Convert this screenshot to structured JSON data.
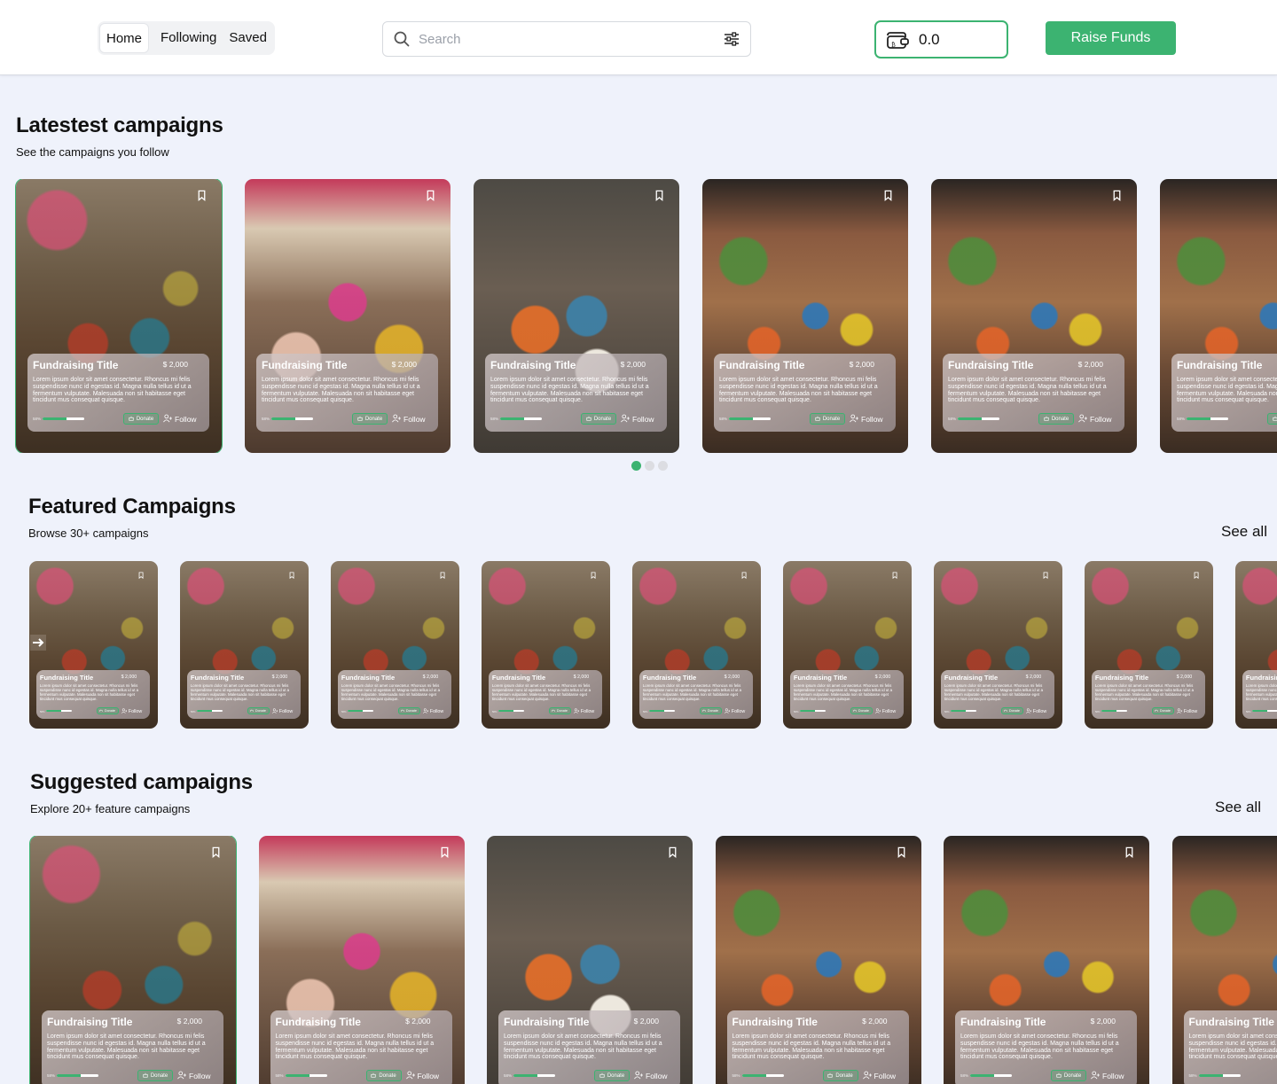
{
  "nav": {
    "tabs": [
      "Home",
      "Following",
      "Saved"
    ],
    "active": 0
  },
  "search": {
    "placeholder": "Search"
  },
  "wallet": {
    "balance": "0.0"
  },
  "raise_funds_label": "Raise Funds",
  "sections": [
    {
      "title": "Latestest campaigns",
      "subtitle": "See the campaigns you follow",
      "see_all": ""
    },
    {
      "title": "Featured Campaigns",
      "subtitle": "Browse 30+ campaigns",
      "see_all": "See all"
    },
    {
      "title": "Suggested campaigns",
      "subtitle": "Explore 20+ feature campaigns",
      "see_all": "See all"
    }
  ],
  "card": {
    "title": "Fundraising Title",
    "amount": "$ 2,000",
    "description": "Lorem ipsum dolor sit amet consectetur. Rhoncus mi felis suspendisse nunc id egestas id. Magna nulla tellus id ut a fermentum vulputate. Malesuada non sit habitasse eget tincidunt mus consequat quisque.",
    "progress_label": "58%",
    "progress": 0.58,
    "donate_label": "Donate",
    "follow_label": "Follow"
  },
  "latest_images": [
    "meeting-hall",
    "street-fundraiser",
    "raise-funds-sign",
    "crowded-hall",
    "crowded-hall",
    "crowded-hall"
  ],
  "featured_images": [
    "meeting-hall",
    "meeting-hall",
    "meeting-hall",
    "meeting-hall",
    "meeting-hall",
    "meeting-hall",
    "meeting-hall",
    "meeting-hall",
    "meeting-hall"
  ],
  "suggested_images": [
    "meeting-hall",
    "street-fundraiser",
    "raise-funds-sign",
    "crowded-hall",
    "crowded-hall",
    "crowded-hall"
  ],
  "carousel": {
    "pages": 3,
    "active": 0
  },
  "colors": {
    "accent": "#3cb371",
    "background": "#eff2fb"
  }
}
